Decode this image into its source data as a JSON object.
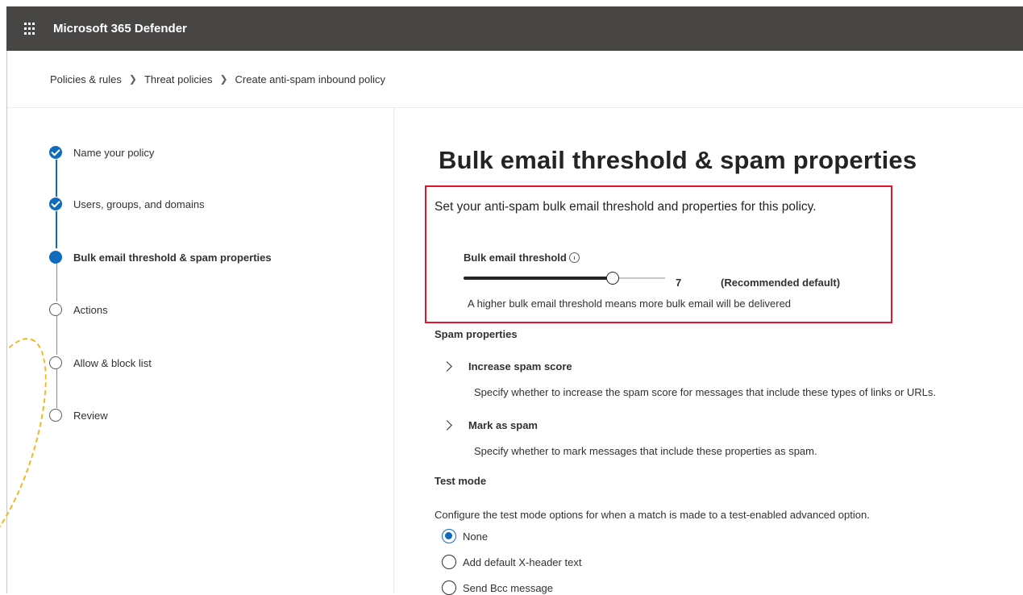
{
  "app": {
    "title": "Microsoft 365 Defender"
  },
  "breadcrumb": [
    "Policies & rules",
    "Threat policies",
    "Create anti-spam inbound policy"
  ],
  "steps": [
    {
      "label": "Name your policy",
      "status": "done"
    },
    {
      "label": "Users, groups, and domains",
      "status": "done"
    },
    {
      "label": "Bulk email threshold & spam properties",
      "status": "current"
    },
    {
      "label": "Actions",
      "status": "todo"
    },
    {
      "label": "Allow & block list",
      "status": "todo"
    },
    {
      "label": "Review",
      "status": "todo"
    }
  ],
  "page": {
    "heading": "Bulk email threshold & spam properties",
    "intro": "Set your anti-spam bulk email threshold and properties for this policy.",
    "threshold": {
      "label": "Bulk email threshold",
      "value": "7",
      "min": 1,
      "max": 9,
      "note": "(Recommended default)",
      "hint": "A higher bulk email threshold means more bulk email will be delivered"
    },
    "spam_properties": {
      "title": "Spam properties",
      "items": [
        {
          "title": "Increase spam score",
          "desc": "Specify whether to increase the spam score for messages that include these types of links or URLs."
        },
        {
          "title": "Mark as spam",
          "desc": "Specify whether to mark messages that include these properties as spam."
        }
      ]
    },
    "test_mode": {
      "title": "Test mode",
      "desc": "Configure the test mode options for when a match is made to a test-enabled advanced option.",
      "options": [
        "None",
        "Add default X-header text",
        "Send Bcc message"
      ],
      "selected": "None"
    }
  },
  "colors": {
    "accent": "#0f6cbd",
    "highlight": "#e3142b",
    "topbar": "#484644",
    "annotation": "#f2b51c"
  }
}
